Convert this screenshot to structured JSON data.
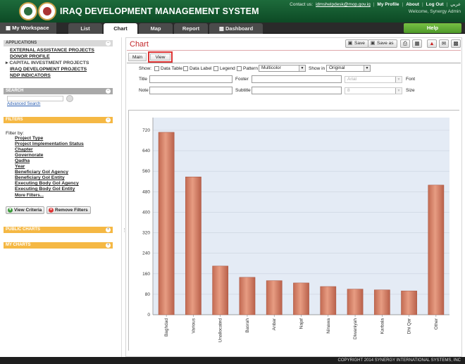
{
  "header": {
    "title": "IRAQ DEVELOPMENT MANAGEMENT SYSTEM",
    "contact_label": "Contact us:",
    "contact_email": "idmshelpdesk@mop.gov.iq",
    "my_profile": "My Profile",
    "about": "About",
    "log_out": "Log Out",
    "arabic": "عربي",
    "welcome": "Welcome, Synergy Admin"
  },
  "nav": {
    "workspace": "My Workspace",
    "tabs": [
      "List",
      "Chart",
      "Map",
      "Report",
      "Dashboard"
    ],
    "active_tab": "Chart",
    "help": "Help"
  },
  "sidebar": {
    "applications_title": "APPLICATIONS",
    "applications": [
      "EXTERNAL ASSISTANCE PROJECTS",
      "DONOR PROFILE",
      "CAPITAL INVESTMENT PROJECTS",
      "IRAQ DEVELOPMENT PROJECTS",
      "NDP INDICATORS"
    ],
    "current_application": "CAPITAL INVESTMENT PROJECTS",
    "search_title": "SEARCH",
    "search_value": "",
    "advanced_search": "Advanced Search",
    "filters_title": "FILTERS",
    "filter_by": "Filter by:",
    "filters": [
      "Project Type",
      "Project Implementation Status",
      "Chapter",
      "Governorate",
      "Qadha",
      "Year",
      "Beneficiary GoI Agency",
      "Beneficiary GoI Entity",
      "Executing Body GoI Agency",
      "Executing Body GoI Entity",
      "More Filters..."
    ],
    "view_criteria": "View Criteria",
    "remove_filters": "Remove Filters",
    "public_charts_title": "PUBLIC CHARTS",
    "my_charts_title": "MY CHARTS"
  },
  "main": {
    "title": "Chart",
    "save": "Save",
    "save_as": "Save as",
    "subtabs": [
      "Main",
      "View"
    ],
    "active_subtab": "View",
    "show_label": "Show:",
    "show_options": [
      "Data Table",
      "Data Label",
      "Legend",
      "Pattern"
    ],
    "color_scheme": "Multicolor",
    "show_in_label": "Show in",
    "show_in_value": "Original",
    "title_label": "Title",
    "title_value": "",
    "footer_label": "Footer",
    "footer_value": "",
    "font_label": "Font",
    "font_value": "Arial",
    "note_label": "Note",
    "note_value": "",
    "subtitle_label": "Subtitle",
    "subtitle_value": "",
    "size_label": "Size",
    "size_value": "8"
  },
  "colors": {
    "header_green": "#0d4a25",
    "accent_red": "#c3262a",
    "bar_fill": "#d98a70",
    "help_green": "#5ba832",
    "panel_orange": "#f5b844"
  },
  "chart_data": {
    "type": "bar",
    "categories": [
      "Baghdad",
      "Various",
      "Unallocated",
      "Basrah",
      "Anbar",
      "Najaf",
      "Ninawa",
      "Diwaniyah",
      "Karbala",
      "Dhi Qar",
      "Other"
    ],
    "values": [
      712,
      538,
      190,
      146,
      133,
      124,
      110,
      100,
      97,
      93,
      506
    ],
    "yticks": [
      0,
      80,
      160,
      240,
      320,
      400,
      480,
      560,
      640,
      720
    ],
    "ylim": [
      0,
      720
    ],
    "grid": true,
    "legend": "none"
  },
  "footer": {
    "copyright": "COPYRIGHT 2014 SYNERGY INTERNATIONAL SYSTEMS, INC"
  }
}
